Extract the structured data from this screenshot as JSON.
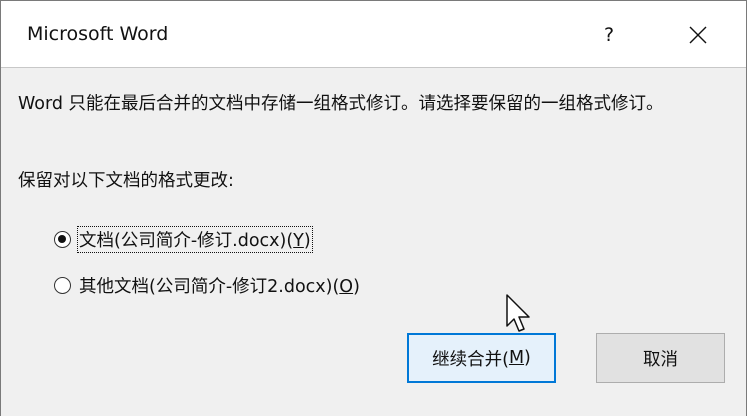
{
  "window": {
    "title": "Microsoft Word",
    "help_label": "?",
    "close_icon": "close-icon"
  },
  "message": "Word 只能在最后合并的文档中存储一组格式修订。请选择要保留的一组格式修订。",
  "prompt": "保留对以下文档的格式更改:",
  "options": [
    {
      "label_prefix": "文档(公司简介-修订.docx)(",
      "accel": "Y",
      "label_suffix": ")",
      "selected": true
    },
    {
      "label_prefix": "其他文档(公司简介-修订2.docx)(",
      "accel": "O",
      "label_suffix": ")",
      "selected": false
    }
  ],
  "buttons": {
    "merge_prefix": "继续合并(",
    "merge_accel": "M",
    "merge_suffix": ")",
    "cancel": "取消"
  },
  "colors": {
    "accent": "#0078d7",
    "content_bg": "#f0f0f0",
    "button_bg": "#e1e1e1"
  }
}
